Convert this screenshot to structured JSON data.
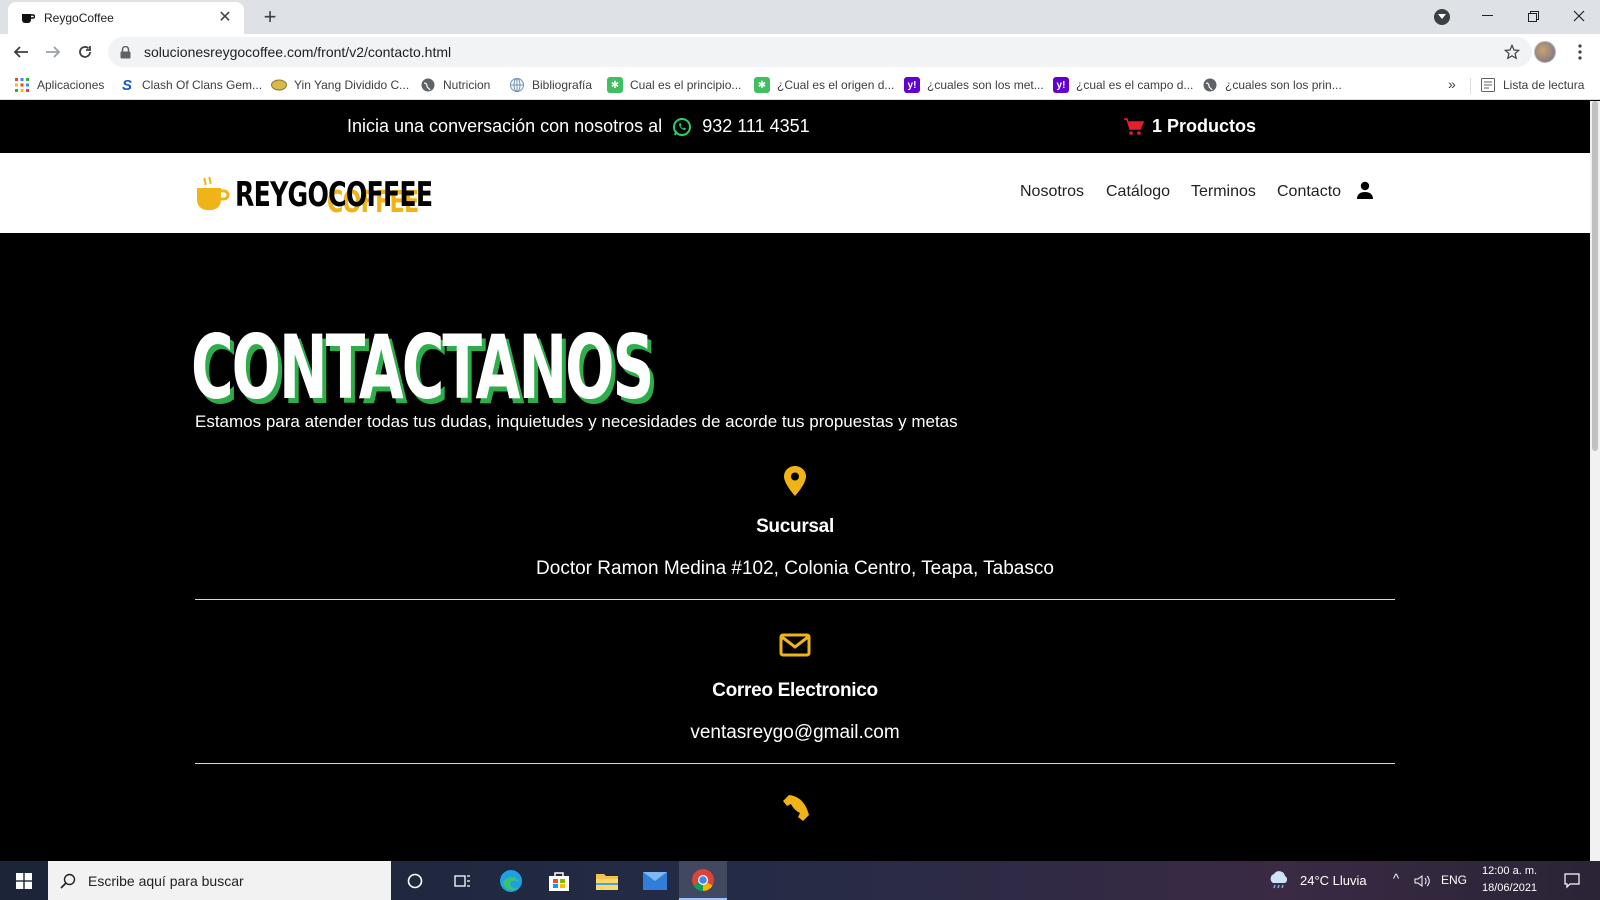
{
  "browser": {
    "tab_title": "ReygoCoffee",
    "url": "solucionesreygocoffee.com/front/v2/contacto.html",
    "bookmarks": [
      {
        "label": "Aplicaciones",
        "icon": "apps-grid-icon"
      },
      {
        "label": "Clash Of Clans Gem...",
        "icon": "s-logo-icon"
      },
      {
        "label": "Yin Yang Dividido C...",
        "icon": "yin-yang-icon"
      },
      {
        "label": "Nutricion",
        "icon": "globe-icon"
      },
      {
        "label": "Bibliografía",
        "icon": "globe-icon"
      },
      {
        "label": "Cual es el principio...",
        "icon": "green-asterisk-icon"
      },
      {
        "label": "¿Cual es el origen d...",
        "icon": "green-asterisk-icon"
      },
      {
        "label": "¿cuales son los met...",
        "icon": "yahoo-icon"
      },
      {
        "label": "¿cual es el campo d...",
        "icon": "yahoo-icon"
      },
      {
        "label": "¿cuales son los prin...",
        "icon": "globe-icon"
      }
    ],
    "reading_list": "Lista de lectura"
  },
  "topbar": {
    "message": "Inicia una conversación con nosotros al",
    "phone": "932 111 4351",
    "cart_label": "1 Productos"
  },
  "header": {
    "logo_front": "REYGOCOFFEE",
    "logo_back": "COFFEE",
    "nav": [
      "Nosotros",
      "Catálogo",
      "Terminos",
      "Contacto"
    ]
  },
  "hero": {
    "title": "CONTACTANOS",
    "subtitle": "Estamos para atender todas tus dudas, inquietudes y necesidades de acorde tus propuestas y metas"
  },
  "contact_blocks": [
    {
      "icon": "map-pin-icon",
      "title": "Sucursal",
      "text": "Doctor Ramon Medina #102, Colonia Centro, Teapa, Tabasco"
    },
    {
      "icon": "envelope-icon",
      "title": "Correo Electronico",
      "text": "ventasreygo@gmail.com"
    },
    {
      "icon": "phone-icon"
    }
  ],
  "taskbar": {
    "search_placeholder": "Escribe aquí para buscar",
    "weather": "24°C  Lluvia",
    "language": "ENG",
    "time": "12:00 a. m.",
    "date": "18/06/2021"
  },
  "colors": {
    "accent_yellow": "#f0b418",
    "title_shadow_green": "#2eae4a",
    "whatsapp_green": "#25d366",
    "cart_red": "#e3212b"
  }
}
